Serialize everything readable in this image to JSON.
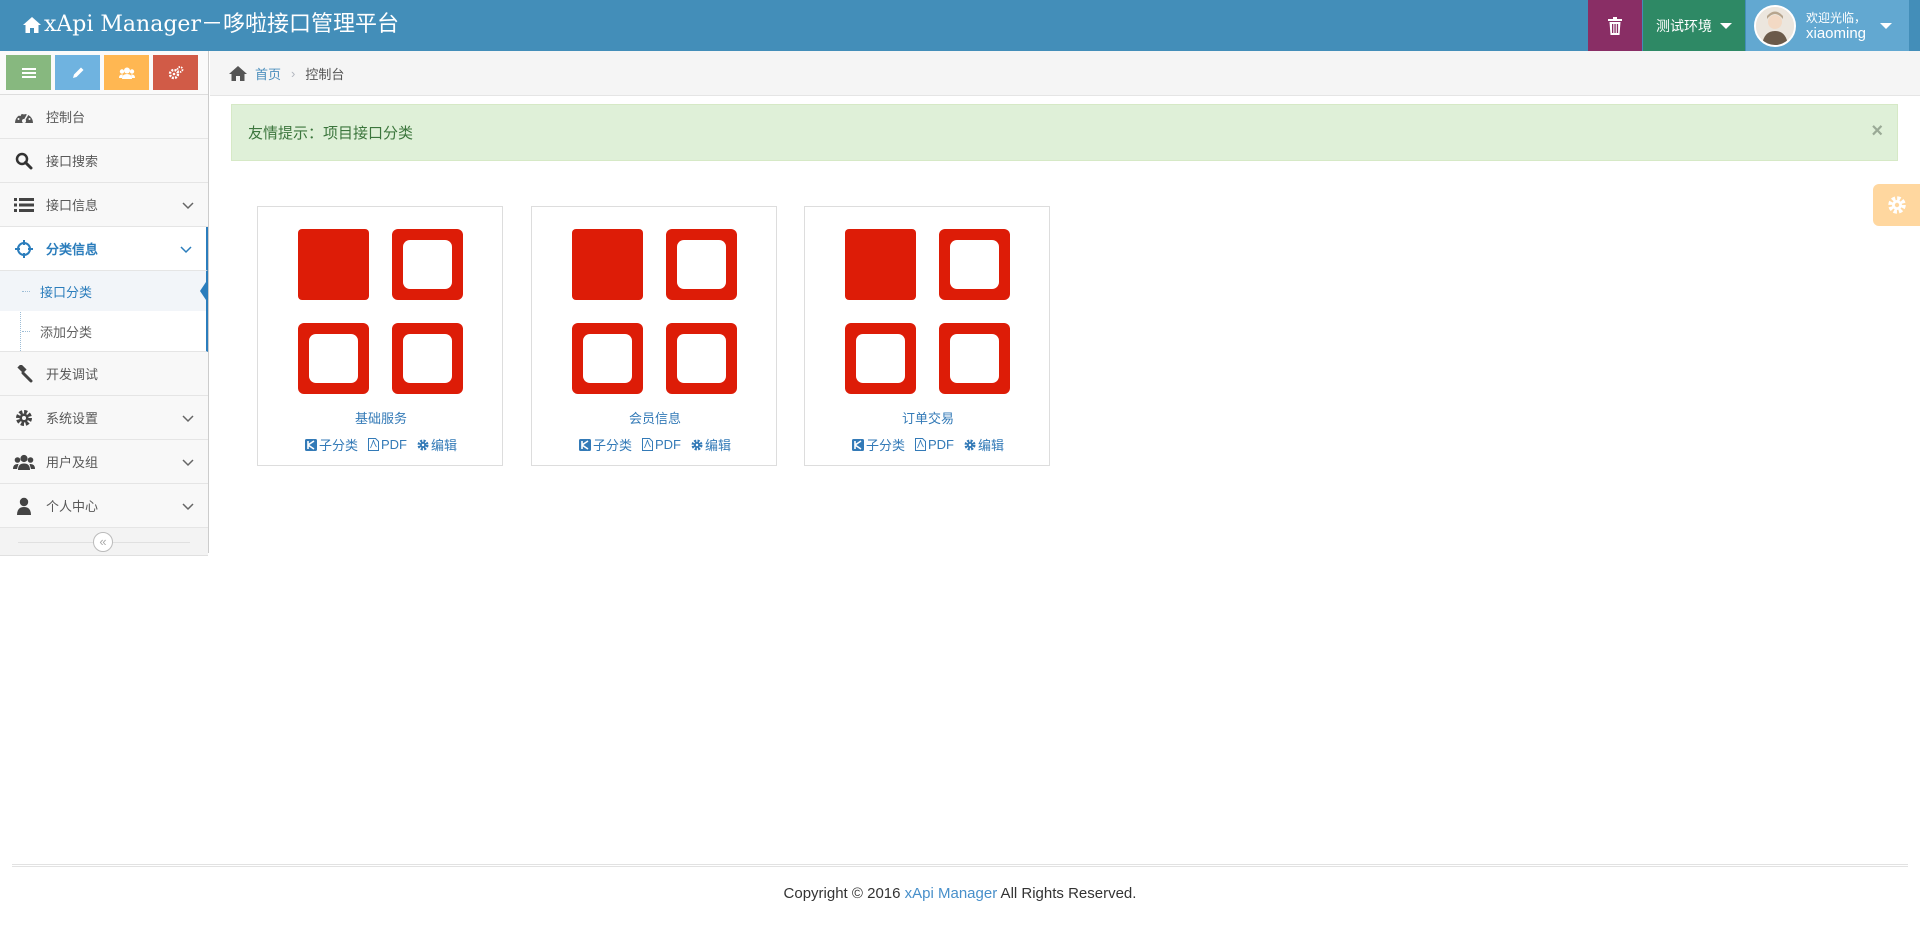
{
  "topbar": {
    "brand": "xApi Manager－哆啦接口管理平台",
    "env_label": "测试环境",
    "user_welcome": "欢迎光临，",
    "user_name": "xiaoming",
    "colors": {
      "bar": "#438eb9",
      "trash": "#892e65",
      "env": "#2e8965",
      "user": "#62a8d1"
    }
  },
  "sidebar": {
    "shortcuts": [
      {
        "icon": "menu-icon",
        "color": "#87b87f"
      },
      {
        "icon": "pencil-icon",
        "color": "#6fb3e0"
      },
      {
        "icon": "users-icon",
        "color": "#ffb752"
      },
      {
        "icon": "cogs-icon",
        "color": "#d15b47"
      }
    ],
    "items": [
      {
        "label": "控制台",
        "icon": "dashboard-icon"
      },
      {
        "label": "接口搜索",
        "icon": "search-icon"
      },
      {
        "label": "接口信息",
        "icon": "list-icon"
      },
      {
        "label": "分类信息",
        "icon": "crosshairs-icon"
      },
      {
        "label": "开发调试",
        "icon": "gavel-icon"
      },
      {
        "label": "系统设置",
        "icon": "gear-icon"
      },
      {
        "label": "用户及组",
        "icon": "users-icon"
      },
      {
        "label": "个人中心",
        "icon": "user-icon"
      }
    ],
    "submenu": [
      {
        "label": "接口分类"
      },
      {
        "label": "添加分类"
      }
    ]
  },
  "breadcrumbs": {
    "home": "首页",
    "current": "控制台"
  },
  "alert": {
    "text": "友情提示：项目接口分类",
    "close": "×"
  },
  "cards": [
    {
      "title": "基础服务",
      "sub": "子分类",
      "pdf": "PDF",
      "edit": "编辑"
    },
    {
      "title": "会员信息",
      "sub": "子分类",
      "pdf": "PDF",
      "edit": "编辑"
    },
    {
      "title": "订单交易",
      "sub": "子分类",
      "pdf": "PDF",
      "edit": "编辑"
    }
  ],
  "tile_color": "#dd1c07",
  "footer": {
    "prefix": "Copyright © 2016 ",
    "brand": "xApi Manager",
    "suffix": " All Rights Reserved."
  }
}
